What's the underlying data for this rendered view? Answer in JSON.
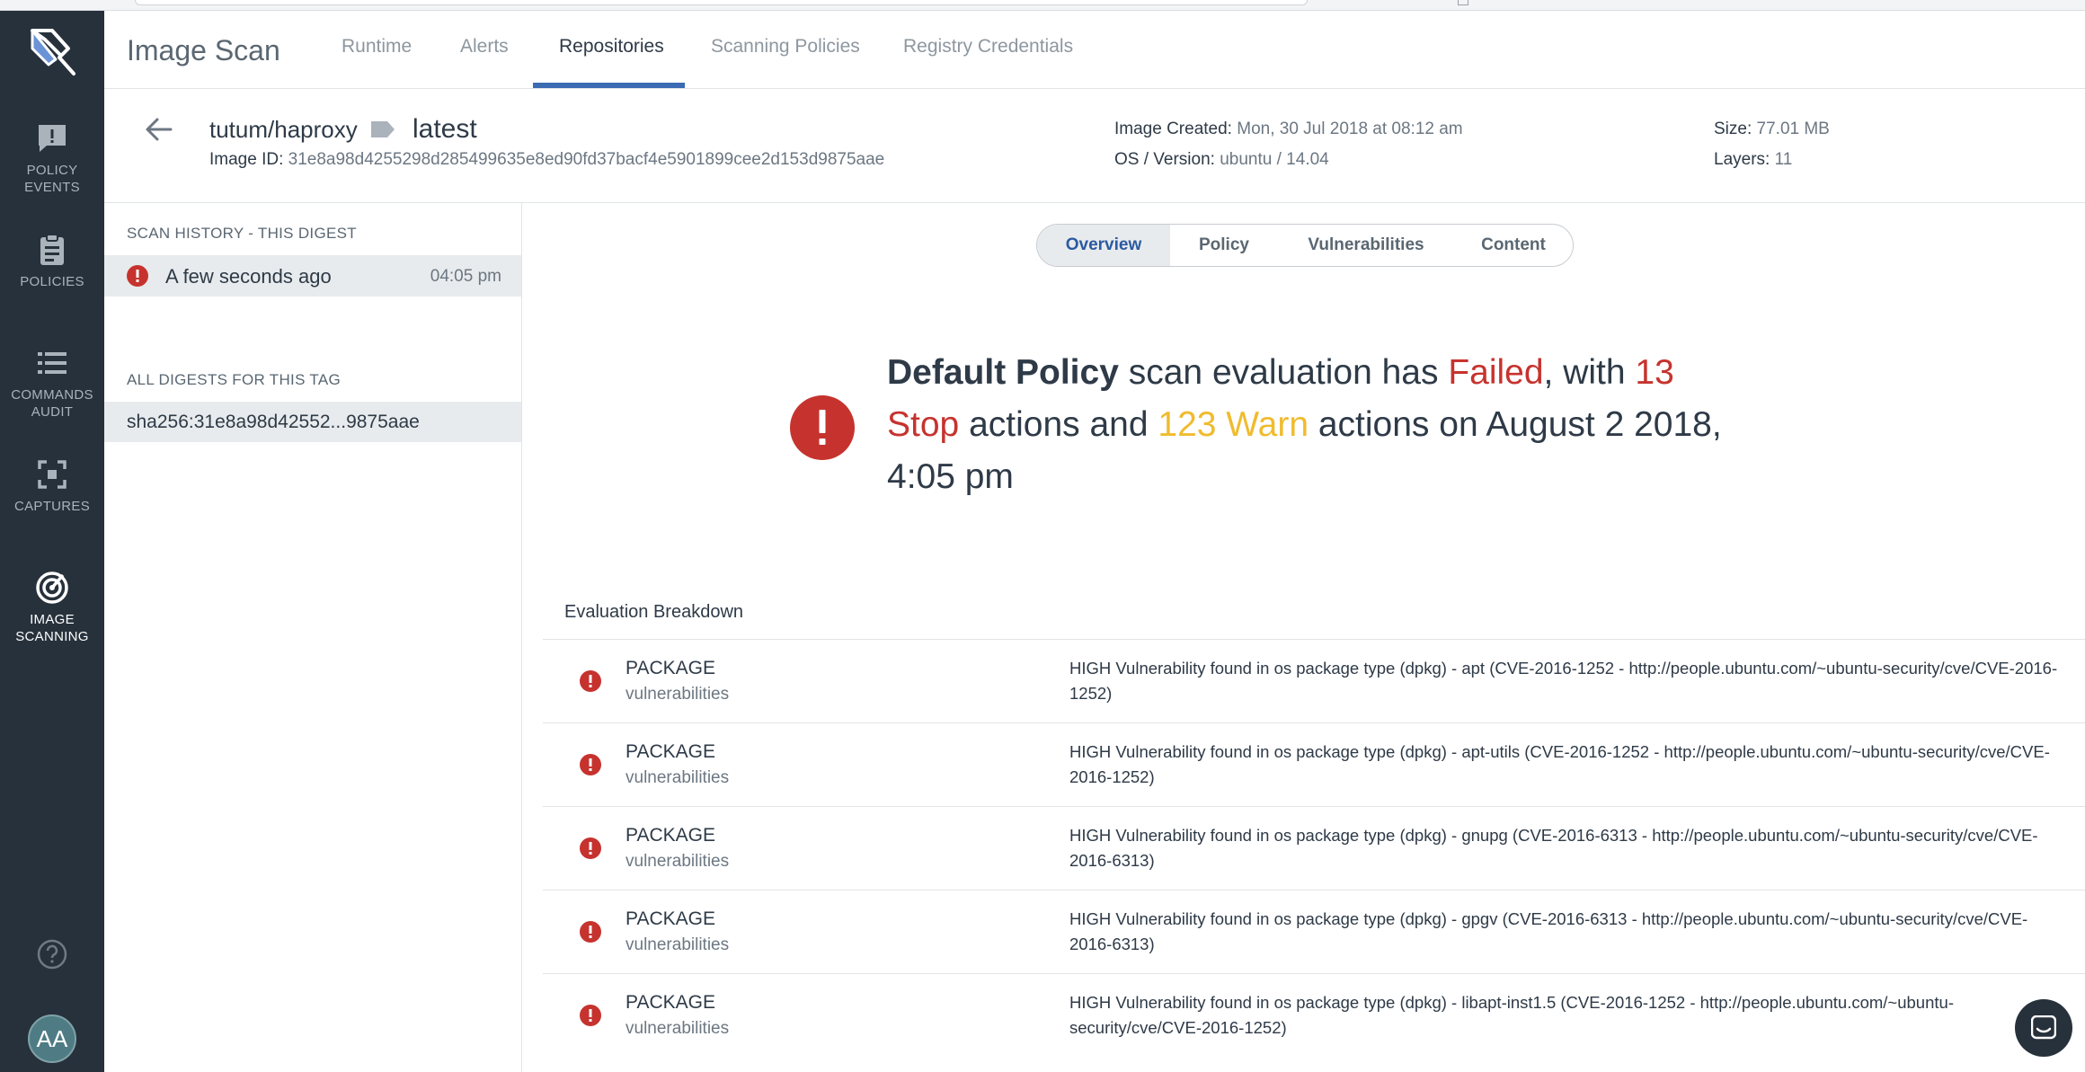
{
  "sidebar": {
    "items": [
      {
        "label_line1": "POLICY",
        "label_line2": "EVENTS",
        "icon": "comment-alert-icon"
      },
      {
        "label_line1": "POLICIES",
        "label_line2": "",
        "icon": "clipboard-icon"
      },
      {
        "label_line1": "COMMANDS",
        "label_line2": "AUDIT",
        "icon": "list-icon"
      },
      {
        "label_line1": "CAPTURES",
        "label_line2": "",
        "icon": "capture-icon"
      },
      {
        "label_line1": "IMAGE",
        "label_line2": "SCANNING",
        "icon": "target-icon"
      }
    ],
    "avatar_initials": "AA"
  },
  "header": {
    "title": "Image Scan",
    "tabs": [
      "Runtime",
      "Alerts",
      "Repositories",
      "Scanning Policies",
      "Registry Credentials"
    ],
    "active_tab": "Repositories"
  },
  "image": {
    "repo": "tutum/haproxy",
    "tag": "latest",
    "id_label": "Image ID:",
    "id_value": "31e8a98d4255298d285499635e8ed90fd37bacf4e5901899cee2d153d9875aae",
    "created_label": "Image Created:",
    "created_value": "Mon, 30 Jul 2018 at 08:12 am",
    "os_label": "OS / Version:",
    "os_value": "ubuntu / 14.04",
    "size_label": "Size:",
    "size_value": "77.01 MB",
    "layers_label": "Layers:",
    "layers_value": "11"
  },
  "scan_history": {
    "title": "SCAN HISTORY - THIS DIGEST",
    "entries": [
      {
        "when": "A few seconds ago",
        "time": "04:05 pm"
      }
    ]
  },
  "digests": {
    "title": "ALL DIGESTS FOR THIS TAG",
    "entries": [
      "sha256:31e8a98d42552...9875aae"
    ]
  },
  "detail_tabs": [
    "Overview",
    "Policy",
    "Vulnerabilities",
    "Content"
  ],
  "summary": {
    "policy": "Default Policy",
    "t1": " scan evaluation has ",
    "result": "Failed",
    "t2": ", with ",
    "stop": "13 Stop",
    "t3": " actions and ",
    "warn": "123 Warn",
    "t4": " actions on August 2 2018, 4:05 pm"
  },
  "breakdown": {
    "title": "Evaluation Breakdown",
    "rows": [
      {
        "gate": "PACKAGE",
        "trigger": "vulnerabilities",
        "message": "HIGH Vulnerability found in os package type (dpkg) - apt (CVE-2016-1252 - http://people.ubuntu.com/~ubuntu-security/cve/CVE-2016-1252)"
      },
      {
        "gate": "PACKAGE",
        "trigger": "vulnerabilities",
        "message": "HIGH Vulnerability found in os package type (dpkg) - apt-utils (CVE-2016-1252 - http://people.ubuntu.com/~ubuntu-security/cve/CVE-2016-1252)"
      },
      {
        "gate": "PACKAGE",
        "trigger": "vulnerabilities",
        "message": "HIGH Vulnerability found in os package type (dpkg) - gnupg (CVE-2016-6313 - http://people.ubuntu.com/~ubuntu-security/cve/CVE-2016-6313)"
      },
      {
        "gate": "PACKAGE",
        "trigger": "vulnerabilities",
        "message": "HIGH Vulnerability found in os package type (dpkg) - gpgv (CVE-2016-6313 - http://people.ubuntu.com/~ubuntu-security/cve/CVE-2016-6313)"
      },
      {
        "gate": "PACKAGE",
        "trigger": "vulnerabilities",
        "message": "HIGH Vulnerability found in os package type (dpkg) - libapt-inst1.5 (CVE-2016-1252 - http://people.ubuntu.com/~ubuntu-security/cve/CVE-2016-1252)"
      }
    ]
  },
  "colors": {
    "sidebar_bg": "#27313b",
    "accent": "#3a6bb3",
    "fail_red": "#c6332e",
    "warn_yellow": "#f0bb2e"
  }
}
